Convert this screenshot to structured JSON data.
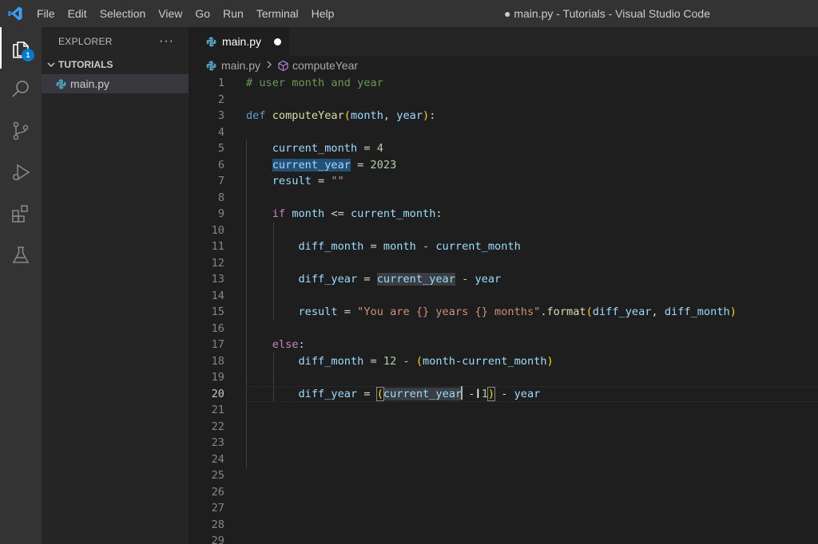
{
  "titlebar": {
    "menu": [
      "File",
      "Edit",
      "Selection",
      "View",
      "Go",
      "Run",
      "Terminal",
      "Help"
    ],
    "window_title": "● main.py - Tutorials - Visual Studio Code"
  },
  "activitybar": {
    "explorer_badge": "1",
    "icons": [
      "files-icon",
      "search-icon",
      "source-control-icon",
      "run-debug-icon",
      "extensions-icon",
      "testing-icon"
    ]
  },
  "sidebar": {
    "title": "EXPLORER",
    "more": "···",
    "section": "TUTORIALS",
    "file": "main.py"
  },
  "tab": {
    "label": "main.py",
    "modified": true
  },
  "breadcrumb": {
    "file": "main.py",
    "symbol": "computeYear"
  },
  "editor": {
    "current_line": 20,
    "line_numbers": [
      "1",
      "2",
      "3",
      "4",
      "5",
      "6",
      "7",
      "8",
      "9",
      "10",
      "11",
      "12",
      "13",
      "14",
      "15",
      "16",
      "17",
      "18",
      "19",
      "20",
      "21",
      "22",
      "23",
      "24",
      "25",
      "26",
      "27",
      "28",
      "29"
    ],
    "lines": {
      "l1": "# user month and year",
      "l3_def": "def",
      "l3_fn": "computeYear",
      "l3_p1": "month",
      "l3_p2": "year",
      "l5_var": "current_month",
      "l5_val": "4",
      "l6_var": "current_year",
      "l6_val": "2023",
      "l7_var": "result",
      "l7_val": "\"\"",
      "l9_kw": "if",
      "l9_a": "month",
      "l9_op": "<=",
      "l9_b": "current_month",
      "l11_a": "diff_month",
      "l11_b": "month",
      "l11_c": "current_month",
      "l13_a": "diff_year",
      "l13_b": "current_year",
      "l13_c": "year",
      "l15_a": "result",
      "l15_str": "\"You are {} years {} months\"",
      "l15_fn": "format",
      "l15_p1": "diff_year",
      "l15_p2": "diff_month",
      "l17_kw": "else",
      "l18_a": "diff_month",
      "l18_num": "12",
      "l18_b": "month-current_month",
      "l20_a": "diff_year",
      "l20_b": "current_year",
      "l20_num": "1",
      "l20_c": "year"
    }
  }
}
